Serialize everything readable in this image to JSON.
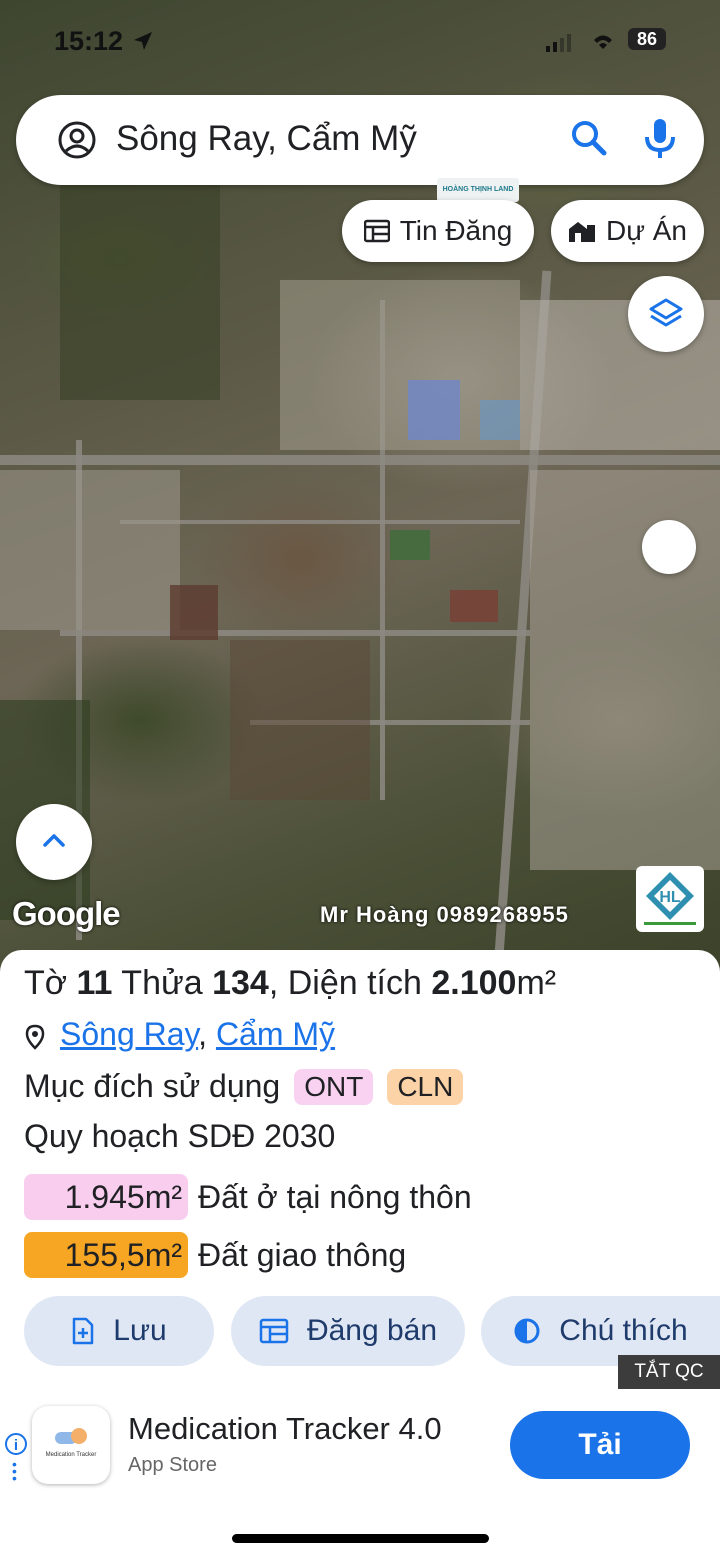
{
  "status_bar": {
    "time": "15:12",
    "battery": "86"
  },
  "search": {
    "text": "Sông Ray, Cẩm Mỹ"
  },
  "chips": {
    "listings": "Tin Đăng",
    "projects": "Dự Án"
  },
  "map": {
    "google_label": "Google",
    "contact": "Mr Hoàng 0989268955",
    "watermark_brand": "HOÀNG THỊNH LAND"
  },
  "parcel": {
    "pre1": "Tờ ",
    "sheet": "11",
    "mid1": " Thửa ",
    "plot": "134",
    "mid2": ", Diện tích ",
    "area": "2.100",
    "unit": "m²",
    "location": {
      "ward": "Sông Ray",
      "sep": ",",
      "district": "Cẩm Mỹ"
    },
    "purpose_label": "Mục đích sử dụng",
    "purpose_codes": [
      "ONT",
      "CLN"
    ],
    "plan_label": "Quy hoạch SDĐ 2030",
    "zones": [
      {
        "area": "1.945m²",
        "label": "Đất ở tại nông thôn"
      },
      {
        "area": "155,5m²",
        "label": "Đất giao thông"
      }
    ]
  },
  "actions": {
    "save": "Lưu",
    "sell": "Đăng bán",
    "legend": "Chú thích"
  },
  "ad": {
    "close_label": "TẮT QC",
    "app_name": "Medication Tracker 4.0",
    "store": "App Store",
    "cta": "Tải",
    "icon_text": "Medication Tracker"
  },
  "colors": {
    "accent": "#1a73e8",
    "ont_badge": "#f8d2f0",
    "cln_badge": "#fbd3a6",
    "zone1": "#f8cdee",
    "zone2": "#f6a623"
  }
}
